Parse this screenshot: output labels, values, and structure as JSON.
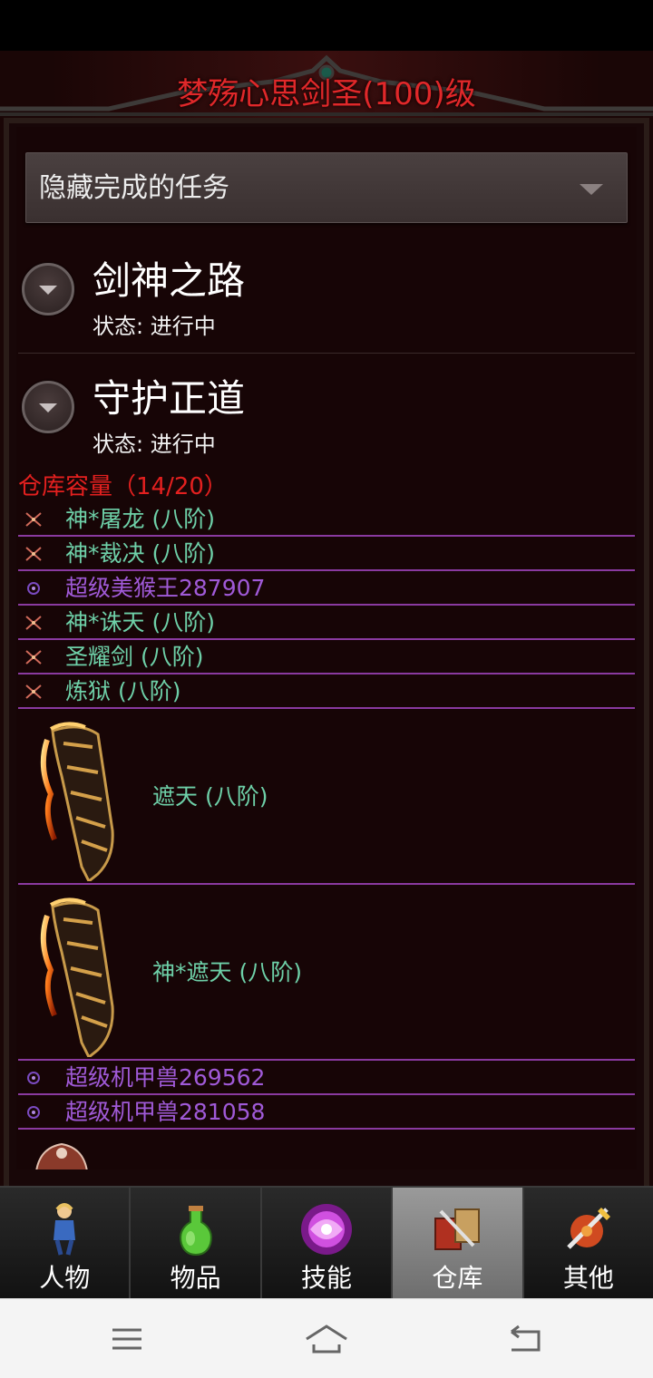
{
  "header": {
    "title": "梦殇心思剑圣(100)级"
  },
  "filter": {
    "selected": "隐藏完成的任务"
  },
  "tasks": [
    {
      "title": "剑神之路",
      "status": "状态: 进行中"
    },
    {
      "title": "守护正道",
      "status": "状态: 进行中"
    }
  ],
  "storage": {
    "capacity_label": "仓库容量（14/20）",
    "items": [
      {
        "name": "神*屠龙 (八阶)",
        "icon": "crossed-swords-icon",
        "color": "#6ed0a8"
      },
      {
        "name": "神*裁决 (八阶)",
        "icon": "crossed-swords-icon",
        "color": "#6ed0a8"
      },
      {
        "name": "超级美猴王287907",
        "icon": "pet-icon",
        "color": "#a05ad8"
      },
      {
        "name": "神*诛天 (八阶)",
        "icon": "crossed-swords-icon",
        "color": "#6ed0a8"
      },
      {
        "name": "圣耀剑 (八阶)",
        "icon": "crossed-swords-icon",
        "color": "#6ed0a8"
      },
      {
        "name": "炼狱 (八阶)",
        "icon": "crossed-swords-icon",
        "color": "#6ed0a8"
      },
      {
        "name": "遮天 (八阶)",
        "icon": "flaming-blade-image",
        "color": "#6ed0a8"
      },
      {
        "name": "神*遮天 (八阶)",
        "icon": "flaming-blade-image",
        "color": "#6ed0a8"
      },
      {
        "name": "超级机甲兽269562",
        "icon": "pet-icon",
        "color": "#a05ad8"
      },
      {
        "name": "超级机甲兽281058",
        "icon": "pet-icon",
        "color": "#a05ad8"
      }
    ]
  },
  "tabs": [
    {
      "label": "人物",
      "icon": "character-icon",
      "active": false
    },
    {
      "label": "物品",
      "icon": "potion-icon",
      "active": false
    },
    {
      "label": "技能",
      "icon": "skill-orb-icon",
      "active": false
    },
    {
      "label": "仓库",
      "icon": "storage-icon",
      "active": true
    },
    {
      "label": "其他",
      "icon": "other-icon",
      "active": false
    }
  ],
  "system_nav": {
    "menu": "menu-icon",
    "home": "home-icon",
    "back": "back-icon"
  }
}
